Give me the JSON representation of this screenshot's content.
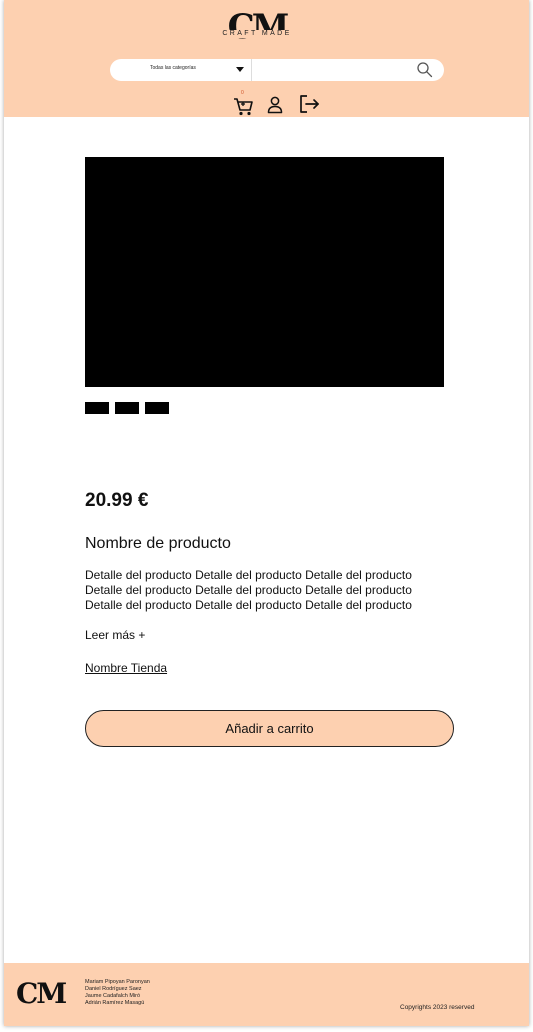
{
  "header": {
    "logo_text": "CM",
    "logo_tagline": "CRAFT MADE",
    "category_select": "Todas las categorías",
    "search_placeholder": "",
    "cart_count": "0"
  },
  "product": {
    "price": "20.99 €",
    "name": "Nombre de producto",
    "description_lines": [
      "Detalle del producto Detalle del producto Detalle del producto",
      "Detalle del producto Detalle del producto Detalle del producto",
      "Detalle del producto Detalle del producto Detalle del producto"
    ],
    "read_more": "Leer más +",
    "store_name": "Nombre Tienda",
    "add_to_cart": "Añadir a carrito"
  },
  "footer": {
    "logo_text": "CM",
    "authors": [
      "Mariam Pipoyan Paronyan",
      "Daniel Rodríguez Saez",
      "Jaume Cadafalch Miró",
      "Adrián Ramírez Masagú"
    ],
    "copyright": "Copyrights 2023 reserved"
  },
  "colors": {
    "accent": "#fdd0b0",
    "text": "#111111",
    "image_placeholder": "#000000"
  },
  "icons": [
    "search-icon",
    "cart-icon",
    "user-icon",
    "logout-icon",
    "chevron-down-icon"
  ]
}
